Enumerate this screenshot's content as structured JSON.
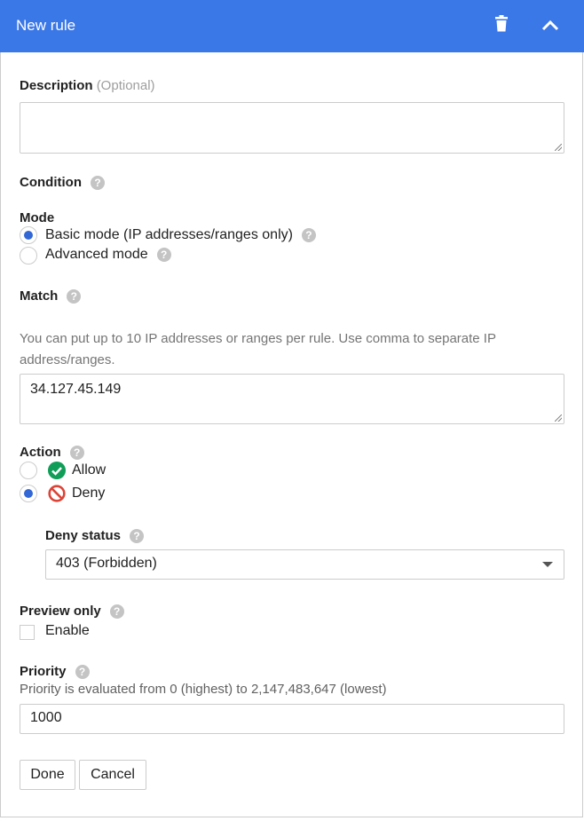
{
  "header": {
    "title": "New rule",
    "delete_icon": "trash-icon",
    "collapse_icon": "chevron-up-icon",
    "color": "#3b78e7"
  },
  "description": {
    "label": "Description",
    "optional": "(Optional)",
    "value": ""
  },
  "condition": {
    "label": "Condition"
  },
  "mode": {
    "label": "Mode",
    "options": [
      {
        "label": "Basic mode (IP addresses/ranges only)",
        "selected": true
      },
      {
        "label": "Advanced mode",
        "selected": false
      }
    ]
  },
  "match": {
    "label": "Match",
    "help_line1": "You can put up to 10 IP addresses or ranges per rule. Use comma to separate IP",
    "help_line2": "address/ranges.",
    "value": "34.127.45.149"
  },
  "action": {
    "label": "Action",
    "options": [
      {
        "label": "Allow",
        "selected": false,
        "icon": "check-circle-icon",
        "color": "#0f9d58"
      },
      {
        "label": "Deny",
        "selected": true,
        "icon": "block-icon",
        "color": "#db4437"
      }
    ]
  },
  "deny_status": {
    "label": "Deny status",
    "value": "403 (Forbidden)"
  },
  "preview": {
    "label": "Preview only",
    "checkbox_label": "Enable",
    "checked": false
  },
  "priority": {
    "label": "Priority",
    "hint": "Priority is evaluated from 0 (highest) to 2,147,483,647 (lowest)",
    "value": "1000"
  },
  "buttons": {
    "done": "Done",
    "cancel": "Cancel"
  }
}
